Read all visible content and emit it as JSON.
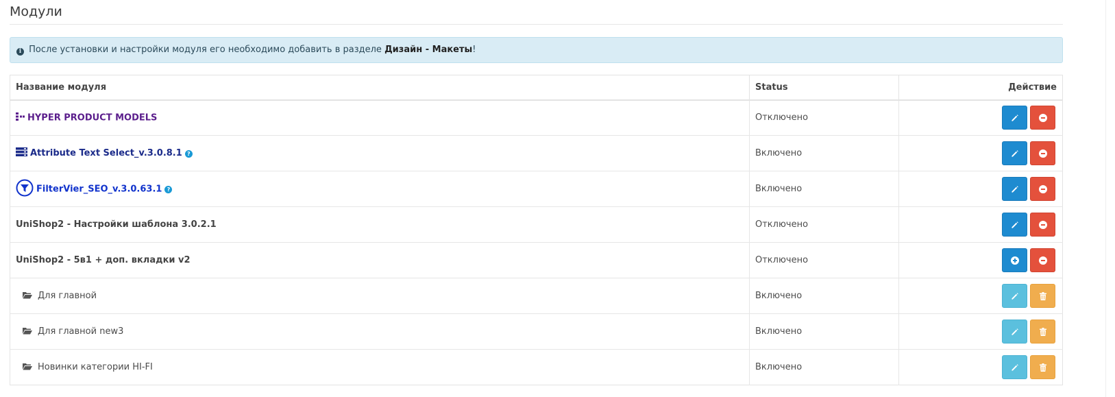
{
  "page": {
    "title": "Модули"
  },
  "alert": {
    "text_before": "После установки и настройки модуля его необходимо добавить в разделе",
    "link_text": "Дизайн - Макеты",
    "text_after": "!"
  },
  "table": {
    "headers": {
      "name": "Название модуля",
      "status": "Status",
      "action": "Действие"
    },
    "rows": [
      {
        "name": "HYPER PRODUCT MODELS",
        "status": "Отключено"
      },
      {
        "name": "Attribute Text Select_v.3.0.8.1",
        "status": "Включено"
      },
      {
        "name": "FilterVier_SEO_v.3.0.63.1",
        "status": "Включено"
      },
      {
        "name": "UniShop2 - Настройки шаблона 3.0.2.1",
        "status": "Отключено"
      },
      {
        "name": "UniShop2 - 5в1 + доп. вкладки v2",
        "status": "Отключено"
      },
      {
        "name": "Для главной",
        "status": "Включено"
      },
      {
        "name": "Для главной new3",
        "status": "Включено"
      },
      {
        "name": "Новинки категории HI-FI",
        "status": "Включено"
      }
    ]
  },
  "colors": {
    "edit_blue": "#1e8bd0",
    "uninstall_red": "#e4513c",
    "edit_lightblue": "#5bc0de",
    "delete_orange": "#f0ad4e",
    "alert_bg": "#d9ecf5"
  }
}
